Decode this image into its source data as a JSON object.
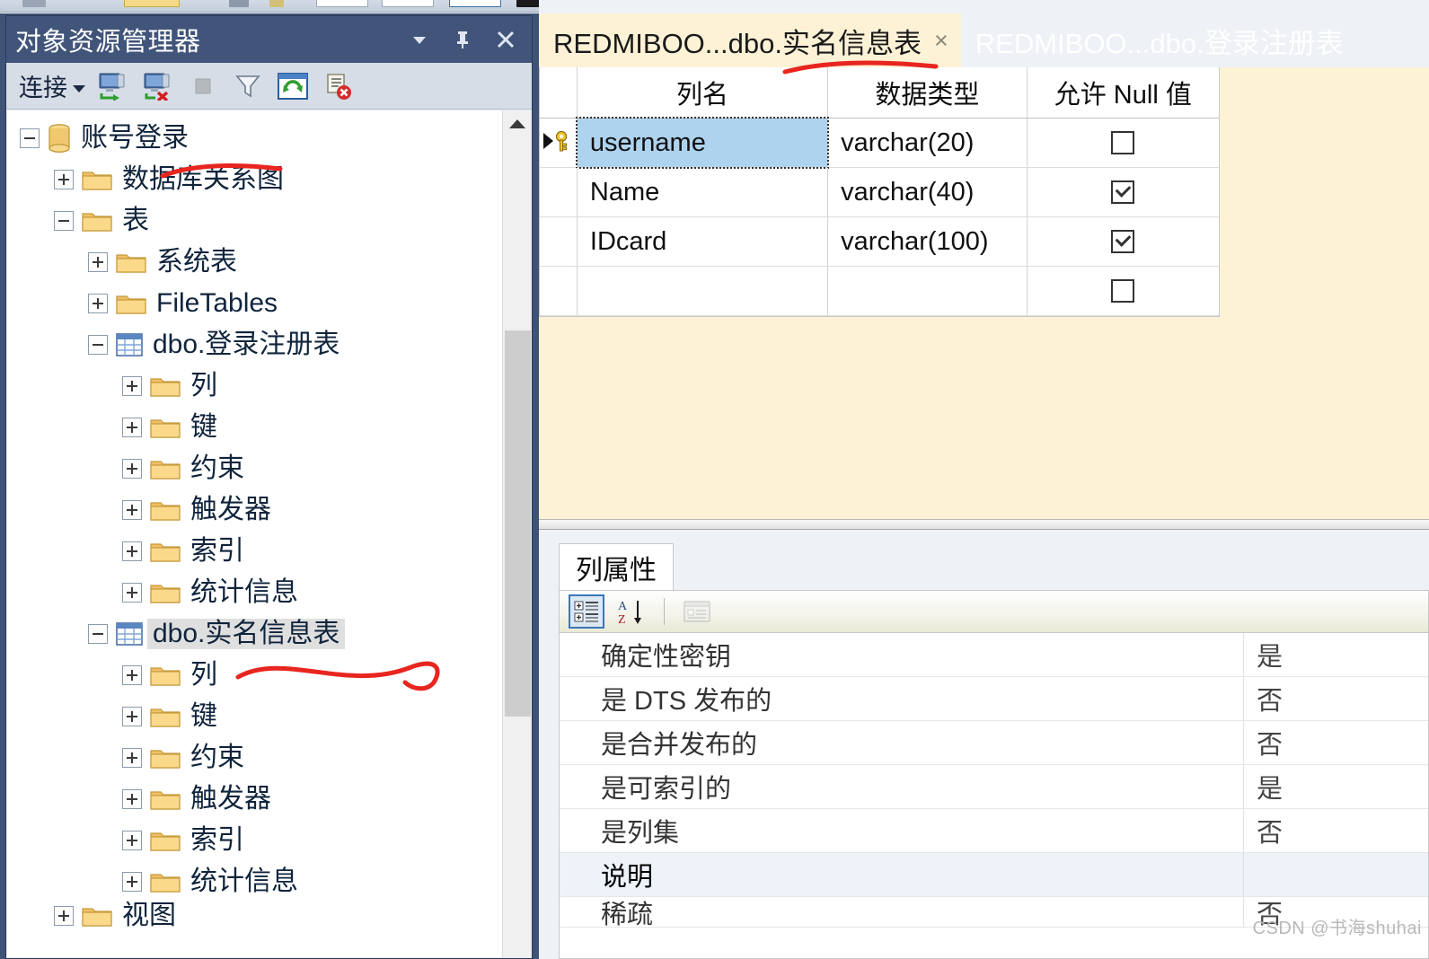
{
  "object_explorer": {
    "title": "对象资源管理器",
    "title_buttons": [
      {
        "name": "window-position-dropdown",
        "icon": "chevron-down-icon"
      },
      {
        "name": "auto-hide-pin",
        "icon": "pin-icon"
      },
      {
        "name": "close-panel",
        "icon": "close-icon"
      }
    ],
    "toolbar": {
      "connect_label": "连接",
      "buttons": [
        {
          "name": "connect-object-explorer",
          "icon": "connect-server-icon"
        },
        {
          "name": "disconnect-object-explorer",
          "icon": "disconnect-server-icon"
        },
        {
          "name": "stop-action",
          "icon": "stop-icon",
          "enabled": false
        },
        {
          "name": "filter",
          "icon": "filter-icon"
        },
        {
          "name": "refresh",
          "icon": "refresh-icon"
        },
        {
          "name": "script-error",
          "icon": "script-error-icon"
        }
      ]
    },
    "tree": [
      {
        "label": "账号登录",
        "icon": "database-icon",
        "level": 0,
        "expander": "minus"
      },
      {
        "label": "数据库关系图",
        "icon": "folder-icon",
        "level": 1,
        "expander": "plus"
      },
      {
        "label": "表",
        "icon": "folder-icon",
        "level": 1,
        "expander": "minus"
      },
      {
        "label": "系统表",
        "icon": "folder-icon",
        "level": 2,
        "expander": "plus"
      },
      {
        "label": "FileTables",
        "icon": "folder-icon",
        "level": 2,
        "expander": "plus"
      },
      {
        "label": "dbo.登录注册表",
        "icon": "table-icon",
        "level": 2,
        "expander": "minus"
      },
      {
        "label": "列",
        "icon": "folder-icon",
        "level": 3,
        "expander": "plus"
      },
      {
        "label": "键",
        "icon": "folder-icon",
        "level": 3,
        "expander": "plus"
      },
      {
        "label": "约束",
        "icon": "folder-icon",
        "level": 3,
        "expander": "plus"
      },
      {
        "label": "触发器",
        "icon": "folder-icon",
        "level": 3,
        "expander": "plus"
      },
      {
        "label": "索引",
        "icon": "folder-icon",
        "level": 3,
        "expander": "plus"
      },
      {
        "label": "统计信息",
        "icon": "folder-icon",
        "level": 3,
        "expander": "plus"
      },
      {
        "label": "dbo.实名信息表",
        "icon": "table-icon",
        "level": 2,
        "expander": "minus",
        "selected": true
      },
      {
        "label": "列",
        "icon": "folder-icon",
        "level": 3,
        "expander": "plus"
      },
      {
        "label": "键",
        "icon": "folder-icon",
        "level": 3,
        "expander": "plus"
      },
      {
        "label": "约束",
        "icon": "folder-icon",
        "level": 3,
        "expander": "plus"
      },
      {
        "label": "触发器",
        "icon": "folder-icon",
        "level": 3,
        "expander": "plus"
      },
      {
        "label": "索引",
        "icon": "folder-icon",
        "level": 3,
        "expander": "plus"
      },
      {
        "label": "统计信息",
        "icon": "folder-icon",
        "level": 3,
        "expander": "plus"
      },
      {
        "label": "视图",
        "icon": "folder-icon",
        "level": 1,
        "expander": "plus",
        "clipped": true
      }
    ]
  },
  "editor": {
    "tabs": [
      {
        "label": "REDMIBOO...dbo.实名信息表",
        "active": true,
        "close": "×"
      },
      {
        "label": "REDMIBOO...dbo.登录注册表",
        "active": false
      }
    ],
    "grid": {
      "headers": [
        "列名",
        "数据类型",
        "允许 Null 值"
      ],
      "rows": [
        {
          "selector": "primary-key",
          "name": "username",
          "data_type": "varchar(20)",
          "allow_null": false,
          "selected": true
        },
        {
          "selector": "",
          "name": "Name",
          "data_type": "varchar(40)",
          "allow_null": true,
          "selected": false
        },
        {
          "selector": "",
          "name": "IDcard",
          "data_type": "varchar(100)",
          "allow_null": true,
          "selected": false
        },
        {
          "selector": "",
          "name": "",
          "data_type": "",
          "allow_null": false,
          "selected": false
        }
      ]
    }
  },
  "properties": {
    "tab_label": "列属性",
    "toolbar": [
      {
        "name": "categorized-view",
        "icon": "categorized-icon",
        "pressed": true
      },
      {
        "name": "alphabetical-sort",
        "icon": "sort-az-icon",
        "pressed": false
      },
      {
        "name": "property-pages",
        "icon": "property-pages-icon",
        "pressed": false,
        "enabled": false
      }
    ],
    "rows": [
      {
        "name": "确定性密钥",
        "value": "是"
      },
      {
        "name": "是 DTS 发布的",
        "value": "否"
      },
      {
        "name": "是合并发布的",
        "value": "否"
      },
      {
        "name": "是可索引的",
        "value": "是"
      },
      {
        "name": "是列集",
        "value": "否"
      },
      {
        "name": "说明",
        "value": "",
        "highlighted": true
      },
      {
        "name": "稀疏",
        "value": "否",
        "clipped": true
      }
    ]
  },
  "watermark": "CSDN @书海shuhai",
  "colors": {
    "title_bar": "#41547a",
    "shell": "#3f5277",
    "active_tab": "#fdf2d6",
    "selection": "#aed3ee",
    "annotation": "#e8251f"
  }
}
